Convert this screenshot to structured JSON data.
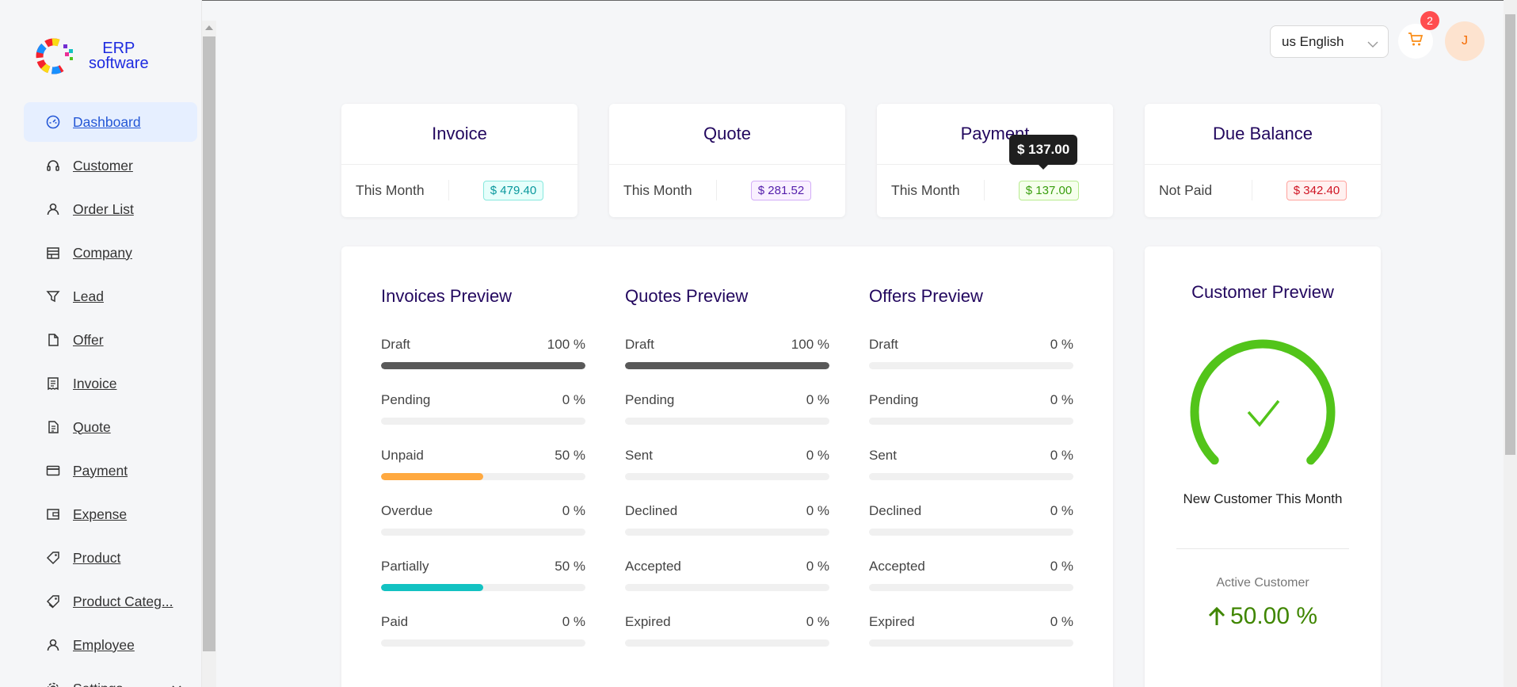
{
  "logo": {
    "line1": "ERP",
    "line2": "software"
  },
  "nav": [
    {
      "label": "Dashboard",
      "icon": "dashboard-icon",
      "active": true
    },
    {
      "label": "Customer",
      "icon": "headset-icon"
    },
    {
      "label": "Order List",
      "icon": "user-icon"
    },
    {
      "label": "Company",
      "icon": "shop-icon"
    },
    {
      "label": "Lead",
      "icon": "filter-icon"
    },
    {
      "label": "Offer",
      "icon": "file-icon"
    },
    {
      "label": "Invoice",
      "icon": "receipt-icon"
    },
    {
      "label": "Quote",
      "icon": "file-sync-icon"
    },
    {
      "label": "Payment",
      "icon": "credit-card-icon"
    },
    {
      "label": "Expense",
      "icon": "wallet-icon"
    },
    {
      "label": "Product",
      "icon": "tag-icon"
    },
    {
      "label": "Product Categ...",
      "icon": "tags-icon"
    },
    {
      "label": "Employee",
      "icon": "user-icon"
    },
    {
      "label": "Settings",
      "icon": "gear-icon"
    }
  ],
  "header": {
    "language": "us English",
    "cart_count": "2",
    "avatar_initial": "J"
  },
  "summary": [
    {
      "title": "Invoice",
      "prefix": "This Month",
      "value": "$ 479.40",
      "color": "cyan"
    },
    {
      "title": "Quote",
      "prefix": "This Month",
      "value": "$ 281.52",
      "color": "purple"
    },
    {
      "title": "Payment",
      "prefix": "This Month",
      "value": "$ 137.00",
      "color": "green"
    },
    {
      "title": "Due Balance",
      "prefix": "Not Paid",
      "value": "$ 342.40",
      "color": "red"
    }
  ],
  "tooltip": "$ 137.00",
  "previews": [
    {
      "title": "Invoices Preview",
      "rows": [
        {
          "label": "Draft",
          "percent": 100,
          "text": "100 %",
          "color": "#595959"
        },
        {
          "label": "Pending",
          "percent": 0,
          "text": "0 %",
          "color": "#1890ff"
        },
        {
          "label": "Unpaid",
          "percent": 50,
          "text": "50 %",
          "color": "#ffa940"
        },
        {
          "label": "Overdue",
          "percent": 0,
          "text": "0 %",
          "color": "#ff4d4f"
        },
        {
          "label": "Partially",
          "percent": 50,
          "text": "50 %",
          "color": "#13c2c2"
        },
        {
          "label": "Paid",
          "percent": 0,
          "text": "0 %",
          "color": "#52c41a"
        }
      ]
    },
    {
      "title": "Quotes Preview",
      "rows": [
        {
          "label": "Draft",
          "percent": 100,
          "text": "100 %",
          "color": "#595959"
        },
        {
          "label": "Pending",
          "percent": 0,
          "text": "0 %",
          "color": "#1890ff"
        },
        {
          "label": "Sent",
          "percent": 0,
          "text": "0 %",
          "color": "#722ed1"
        },
        {
          "label": "Declined",
          "percent": 0,
          "text": "0 %",
          "color": "#ff4d4f"
        },
        {
          "label": "Accepted",
          "percent": 0,
          "text": "0 %",
          "color": "#52c41a"
        },
        {
          "label": "Expired",
          "percent": 0,
          "text": "0 %",
          "color": "#faad14"
        }
      ]
    },
    {
      "title": "Offers Preview",
      "rows": [
        {
          "label": "Draft",
          "percent": 0,
          "text": "0 %",
          "color": "#595959"
        },
        {
          "label": "Pending",
          "percent": 0,
          "text": "0 %",
          "color": "#1890ff"
        },
        {
          "label": "Sent",
          "percent": 0,
          "text": "0 %",
          "color": "#722ed1"
        },
        {
          "label": "Declined",
          "percent": 0,
          "text": "0 %",
          "color": "#ff4d4f"
        },
        {
          "label": "Accepted",
          "percent": 0,
          "text": "0 %",
          "color": "#52c41a"
        },
        {
          "label": "Expired",
          "percent": 0,
          "text": "0 %",
          "color": "#faad14"
        }
      ]
    }
  ],
  "customer": {
    "title": "Customer Preview",
    "gauge_percent": 100,
    "gauge_color": "#52c41a",
    "new_label": "New Customer This Month",
    "active_label": "Active Customer",
    "active_value": "50.00 %"
  }
}
